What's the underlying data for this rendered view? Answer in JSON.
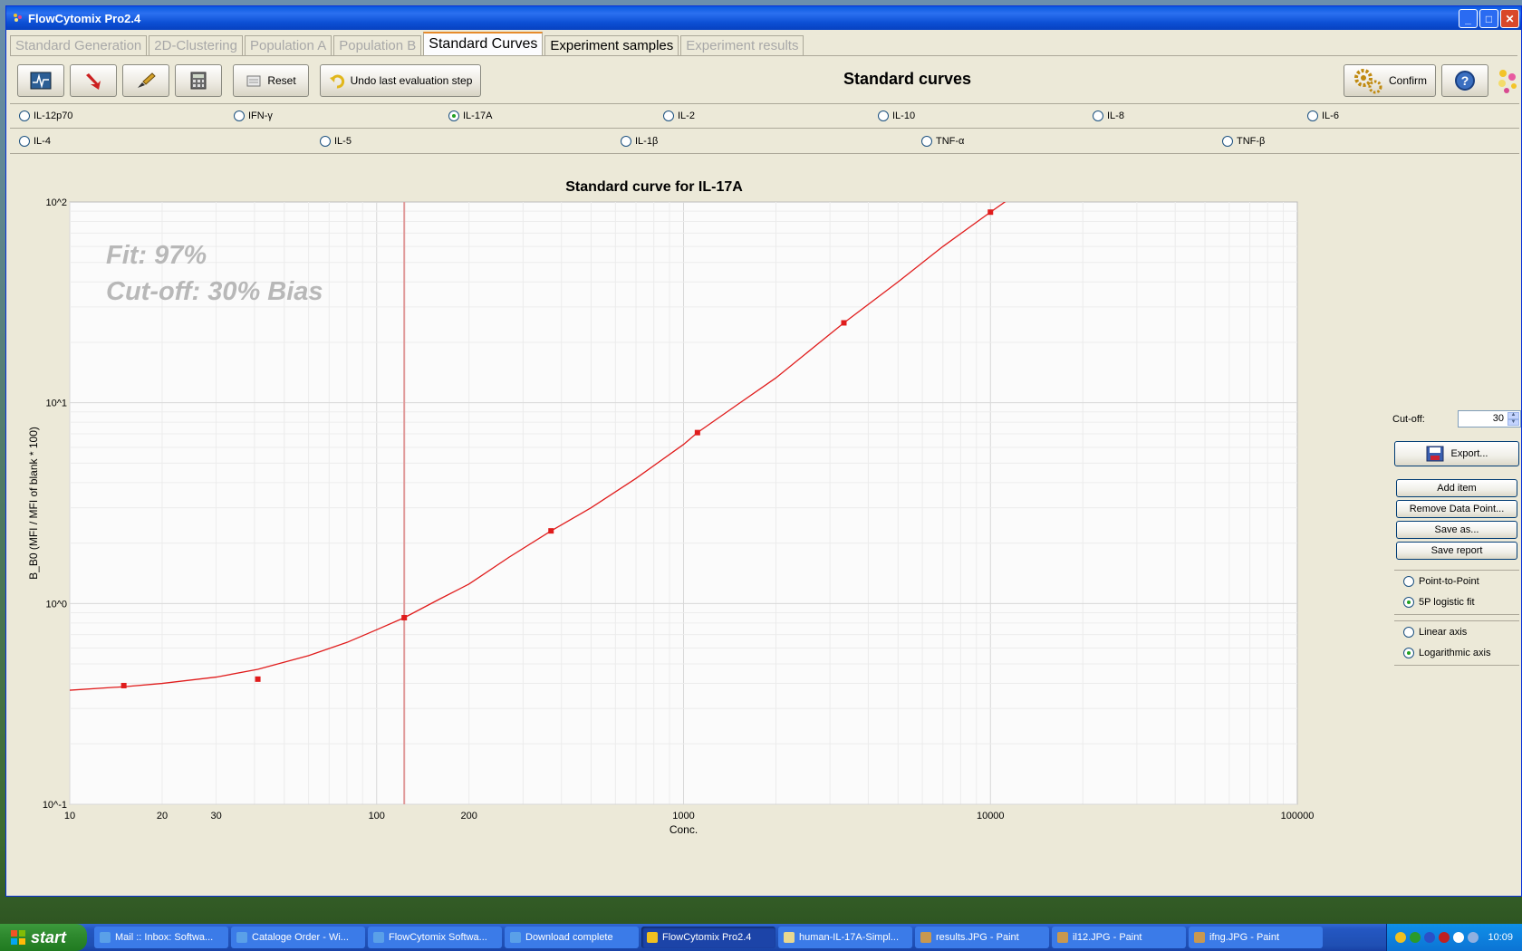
{
  "window": {
    "title": "FlowCytomix Pro2.4"
  },
  "tabs": [
    {
      "label": "Standard Generation",
      "state": "disabled"
    },
    {
      "label": "2D-Clustering",
      "state": "disabled"
    },
    {
      "label": "Population A",
      "state": "disabled"
    },
    {
      "label": "Population B",
      "state": "disabled"
    },
    {
      "label": "Standard Curves",
      "state": "active"
    },
    {
      "label": "Experiment samples",
      "state": "enabled"
    },
    {
      "label": "Experiment results",
      "state": "disabled"
    }
  ],
  "toolbar": {
    "reset_label": "Reset",
    "undo_label": "Undo last evaluation step",
    "heading": "Standard curves",
    "confirm_label": "Confirm",
    "help_label": "?"
  },
  "analytes_row1": [
    {
      "label": "IL-12p70",
      "checked": false
    },
    {
      "label": "IFN-γ",
      "checked": false
    },
    {
      "label": "IL-17A",
      "checked": true
    },
    {
      "label": "IL-2",
      "checked": false
    },
    {
      "label": "IL-10",
      "checked": false
    },
    {
      "label": "IL-8",
      "checked": false
    },
    {
      "label": "IL-6",
      "checked": false
    }
  ],
  "analytes_row2": [
    {
      "label": "IL-4",
      "checked": false
    },
    {
      "label": "IL-5",
      "checked": false
    },
    {
      "label": "IL-1β",
      "checked": false
    },
    {
      "label": "TNF-α",
      "checked": false
    },
    {
      "label": "TNF-β",
      "checked": false
    }
  ],
  "chart_data": {
    "type": "scatter",
    "title": "Standard curve for  IL-17A",
    "xlabel": "Conc.",
    "ylabel": "B_B0 (MFI / MFI of blank * 100)",
    "xscale": "log",
    "yscale": "log",
    "xlim": [
      10,
      100000
    ],
    "ylim": [
      0.1,
      100
    ],
    "x_tick_labels": [
      "10",
      "20",
      "30",
      "100",
      "200",
      "1000",
      "10000",
      "100000"
    ],
    "y_tick_labels": [
      "10^-1",
      "10^0",
      "10^1",
      "10^2"
    ],
    "grid": true,
    "annotations": [
      "Fit: 97%",
      "Cut-off: 30% Bias"
    ],
    "cutoff_line_x": 123,
    "series": [
      {
        "points": {
          "x": [
            15,
            41,
            123,
            370,
            1110,
            3330,
            10000
          ],
          "y": [
            0.39,
            0.42,
            0.85,
            2.3,
            7.1,
            25,
            89
          ]
        }
      }
    ],
    "fit_curve": {
      "x": [
        10,
        15,
        20,
        30,
        41,
        60,
        80,
        100,
        123,
        160,
        200,
        270,
        370,
        500,
        700,
        1000,
        1110,
        1500,
        2000,
        3330,
        5000,
        7000,
        10000,
        13000
      ],
      "y": [
        0.37,
        0.385,
        0.4,
        0.43,
        0.47,
        0.55,
        0.64,
        0.74,
        0.85,
        1.05,
        1.25,
        1.7,
        2.3,
        3.0,
        4.2,
        6.2,
        7.1,
        9.8,
        13.3,
        25,
        40,
        60,
        89,
        118
      ]
    },
    "colors": {
      "series": "#e01c1c",
      "cutoff": "#e09a9a"
    }
  },
  "side": {
    "cutoff_label": "Cut-off:",
    "cutoff_value": "30",
    "export_label": "Export...",
    "buttons": [
      "Add item",
      "Remove Data Point...",
      "Save as...",
      "Save report"
    ],
    "fit_options": [
      {
        "label": "Point-to-Point",
        "checked": false
      },
      {
        "label": "5P logistic fit",
        "checked": true
      }
    ],
    "axis_options": [
      {
        "label": "Linear axis",
        "checked": false
      },
      {
        "label": "Logarithmic axis",
        "checked": true
      }
    ]
  },
  "taskbar": {
    "start_label": "start",
    "items": [
      {
        "label": "Mail :: Inbox: Softwa...",
        "active": false
      },
      {
        "label": "Cataloge Order - Wi...",
        "active": false
      },
      {
        "label": "FlowCytomix Softwa...",
        "active": false
      },
      {
        "label": "Download complete",
        "active": false
      },
      {
        "label": "FlowCytomix Pro2.4",
        "active": true
      },
      {
        "label": "human-IL-17A-Simpl...",
        "active": false
      },
      {
        "label": "results.JPG - Paint",
        "active": false
      },
      {
        "label": "il12.JPG - Paint",
        "active": false
      },
      {
        "label": "ifng.JPG - Paint",
        "active": false
      }
    ],
    "clock": "10:09"
  }
}
